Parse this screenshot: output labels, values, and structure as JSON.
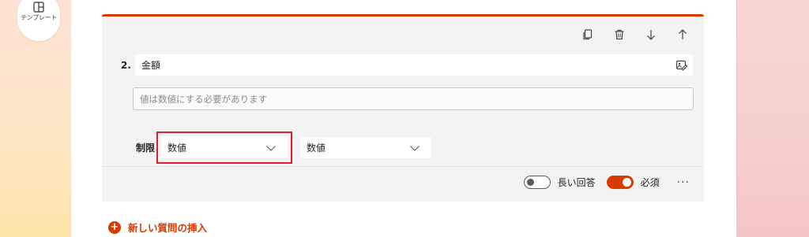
{
  "sidebar": {
    "template_label": "テンプレート",
    "template_icon": "layout-icon"
  },
  "question": {
    "number": "2.",
    "title": "金額",
    "answer_placeholder": "値は数値にする必要があります",
    "restriction": {
      "label": "制限",
      "type_value": "数値",
      "condition_value": "数値"
    },
    "toolbar": {
      "icons": [
        "copy-icon",
        "delete-icon",
        "move-down-icon",
        "move-up-icon"
      ]
    },
    "footer": {
      "long_answer_label": "長い回答",
      "long_answer_on": false,
      "required_label": "必須",
      "required_on": true,
      "more_label": "···"
    }
  },
  "insert_question_label": "新しい質問の挿入",
  "colors": {
    "accent": "#d83b01",
    "highlight_box": "#e02030"
  }
}
